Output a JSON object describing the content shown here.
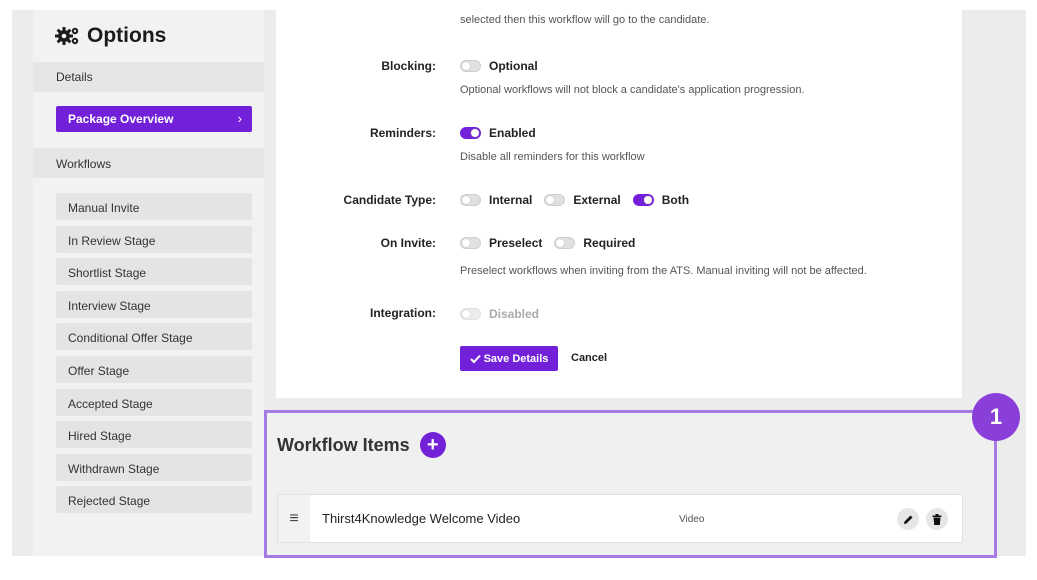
{
  "sidebar": {
    "title": "Options",
    "details_label": "Details",
    "package_overview": "Package Overview",
    "workflows_label": "Workflows",
    "stages": [
      "Manual Invite",
      "In Review Stage",
      "Shortlist Stage",
      "Interview Stage",
      "Conditional Offer Stage",
      "Offer Stage",
      "Accepted Stage",
      "Hired Stage",
      "Withdrawn Stage",
      "Rejected Stage"
    ]
  },
  "form": {
    "top_text_line": "selected then this workflow will go to the candidate.",
    "blocking": {
      "label": "Blocking:",
      "option": "Optional",
      "helper": "Optional workflows will not block a candidate's application progression."
    },
    "reminders": {
      "label": "Reminders:",
      "option": "Enabled",
      "helper": "Disable all reminders for this workflow"
    },
    "candidate_type": {
      "label": "Candidate Type:",
      "options": [
        "Internal",
        "External",
        "Both"
      ]
    },
    "on_invite": {
      "label": "On Invite:",
      "options": [
        "Preselect",
        "Required"
      ],
      "helper": "Preselect workflows when inviting from the ATS. Manual inviting will not be affected."
    },
    "integration": {
      "label": "Integration:",
      "option": "Disabled"
    },
    "save_label": "Save Details",
    "cancel_label": "Cancel"
  },
  "workflow_items": {
    "title": "Workflow Items",
    "items": [
      {
        "name": "Thirst4Knowledge Welcome Video",
        "type": "Video"
      }
    ]
  },
  "annotation": {
    "badge": "1"
  },
  "colors": {
    "accent": "#7321d8",
    "highlight_border": "#a67be6"
  }
}
